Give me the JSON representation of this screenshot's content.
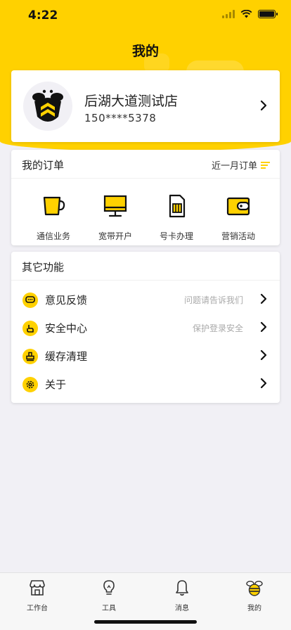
{
  "status": {
    "time": "4:22"
  },
  "header": {
    "title": "我的"
  },
  "profile": {
    "shop_name": "后湖大道测试店",
    "phone": "150****5378"
  },
  "orders": {
    "title": "我的订单",
    "link_label": "近一月订单",
    "items": [
      {
        "label": "通信业务",
        "icon": "cup-icon"
      },
      {
        "label": "宽带开户",
        "icon": "monitor-icon"
      },
      {
        "label": "号卡办理",
        "icon": "sim-card-icon"
      },
      {
        "label": "营销活动",
        "icon": "wallet-icon"
      }
    ]
  },
  "other": {
    "title": "其它功能",
    "items": [
      {
        "label": "意见反馈",
        "hint": "问题请告诉我们",
        "icon": "chat-icon"
      },
      {
        "label": "安全中心",
        "hint": "保护登录安全",
        "icon": "hand-icon"
      },
      {
        "label": "缓存清理",
        "hint": "",
        "icon": "stamp-icon"
      },
      {
        "label": "关于",
        "hint": "",
        "icon": "gear-icon"
      }
    ]
  },
  "tabbar": {
    "items": [
      {
        "label": "工作台",
        "icon": "store-icon"
      },
      {
        "label": "工具",
        "icon": "bulb-icon"
      },
      {
        "label": "消息",
        "icon": "bell-icon"
      },
      {
        "label": "我的",
        "icon": "bee-icon"
      }
    ]
  },
  "colors": {
    "accent": "#ffd100",
    "background": "#f1f0f5",
    "card": "#ffffff"
  }
}
